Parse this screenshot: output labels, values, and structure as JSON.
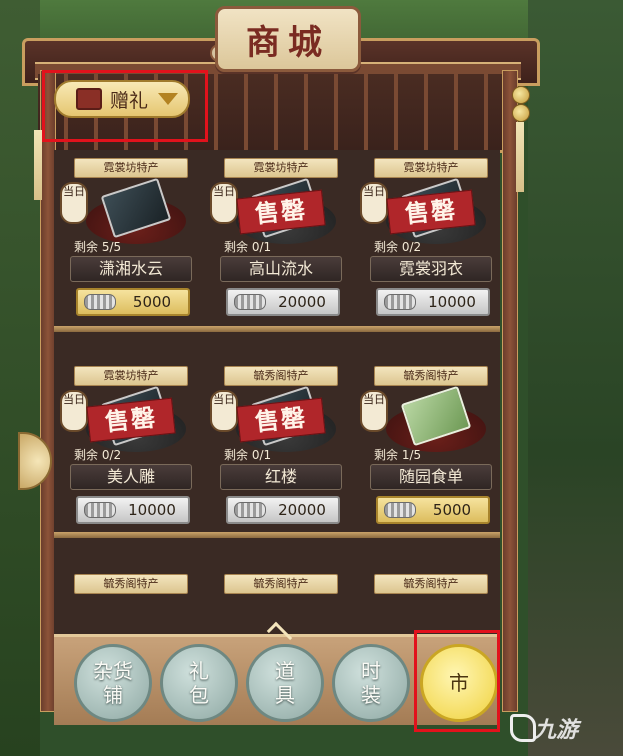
{
  "shop": {
    "title": "商城",
    "category_dropdown": {
      "label": "赠礼"
    }
  },
  "items": [
    {
      "tag": "霓裳坊特产",
      "daily": "当日",
      "remain": "剩余 5/5",
      "name": "潇湘水云",
      "price": "5000",
      "currency": "gold",
      "sold_out": false
    },
    {
      "tag": "霓裳坊特产",
      "daily": "当日",
      "remain": "剩余 0/1",
      "name": "高山流水",
      "price": "20000",
      "currency": "silver",
      "sold_out": true
    },
    {
      "tag": "霓裳坊特产",
      "daily": "当日",
      "remain": "剩余 0/2",
      "name": "霓裳羽衣",
      "price": "10000",
      "currency": "silver",
      "sold_out": true
    },
    {
      "tag": "霓裳坊特产",
      "daily": "当日",
      "remain": "剩余 0/2",
      "name": "美人雕",
      "price": "10000",
      "currency": "silver",
      "sold_out": true
    },
    {
      "tag": "毓秀阁特产",
      "daily": "当日",
      "remain": "剩余 0/1",
      "name": "红楼",
      "price": "20000",
      "currency": "silver",
      "sold_out": true
    },
    {
      "tag": "毓秀阁特产",
      "daily": "当日",
      "remain": "剩余 1/5",
      "name": "随园食单",
      "price": "5000",
      "currency": "gold",
      "sold_out": false
    }
  ],
  "partial_row_tags": [
    "毓秀阁特产",
    "毓秀阁特产",
    "毓秀阁特产"
  ],
  "sold_out_label": "售罄",
  "tabs": [
    {
      "line1": "杂货",
      "line2": "铺"
    },
    {
      "line1": "礼",
      "line2": "包"
    },
    {
      "line1": "道",
      "line2": "具"
    },
    {
      "line1": "时",
      "line2": "装"
    },
    {
      "line1": "市",
      "line2": ""
    }
  ],
  "watermark": "九游",
  "colors": {
    "highlight": "#e2121c",
    "sold_out": "#b0262a",
    "gold_price": "#dcbd5e",
    "silver_price": "#c6c6c6"
  }
}
